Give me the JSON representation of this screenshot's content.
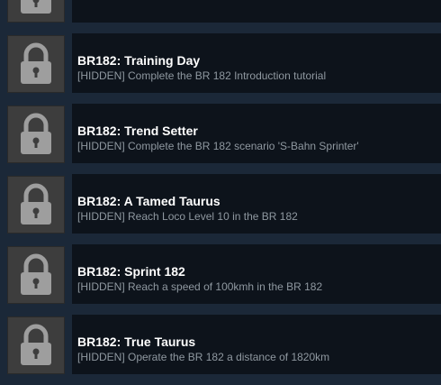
{
  "achievements": [
    {
      "title": "",
      "description": "",
      "icon": "padlock-icon"
    },
    {
      "title": "BR182: Training Day",
      "description": "[HIDDEN] Complete the BR 182 Introduction tutorial",
      "icon": "padlock-icon"
    },
    {
      "title": "BR182: Trend Setter",
      "description": "[HIDDEN] Complete the BR 182 scenario 'S-Bahn Sprinter'",
      "icon": "padlock-icon"
    },
    {
      "title": "BR182: A Tamed Taurus",
      "description": "[HIDDEN] Reach Loco Level 10 in the BR 182",
      "icon": "padlock-icon"
    },
    {
      "title": "BR182: Sprint 182",
      "description": "[HIDDEN] Reach a speed of 100kmh in the BR 182",
      "icon": "padlock-icon"
    },
    {
      "title": "BR182: True Taurus",
      "description": "[HIDDEN] Operate the BR 182 a distance of 1820km",
      "icon": "padlock-icon"
    }
  ],
  "colors": {
    "background": "#1b2838",
    "panel": "#0d131b",
    "icon_background": "#3d3d3d",
    "padlock": "#9e9e9e",
    "title": "#ffffff",
    "description": "#8f98a0"
  }
}
